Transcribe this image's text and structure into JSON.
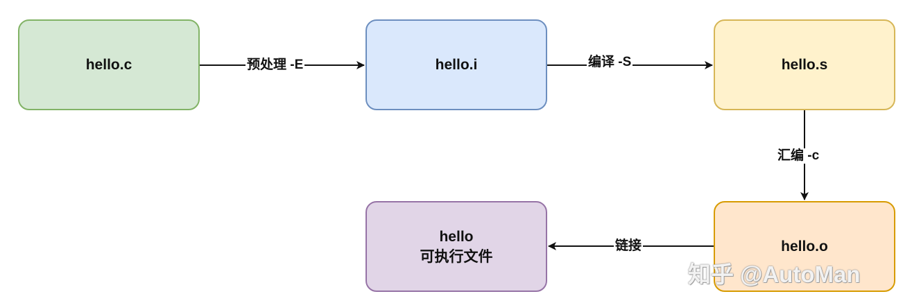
{
  "nodes": {
    "hello_c": "hello.c",
    "hello_i": "hello.i",
    "hello_s": "hello.s",
    "hello_o": "hello.o",
    "executable_line1": "hello",
    "executable_line2": "可执行文件"
  },
  "edges": {
    "preprocess": "预处理 -E",
    "compile": "编译 -S",
    "assemble": "汇编 -c",
    "link": "链接"
  },
  "watermark": "知乎 @AutoMan",
  "colors": {
    "green_fill": "#d5e8d4",
    "green_stroke": "#82b366",
    "blue_fill": "#dae8fc",
    "blue_stroke": "#6c8ebf",
    "yellow_fill": "#fff2cc",
    "yellow_stroke": "#d6b656",
    "orange_fill": "#ffe6cc",
    "orange_stroke": "#d79b00",
    "purple_fill": "#e1d5e7",
    "purple_stroke": "#9673a6",
    "edge": "#111111"
  }
}
